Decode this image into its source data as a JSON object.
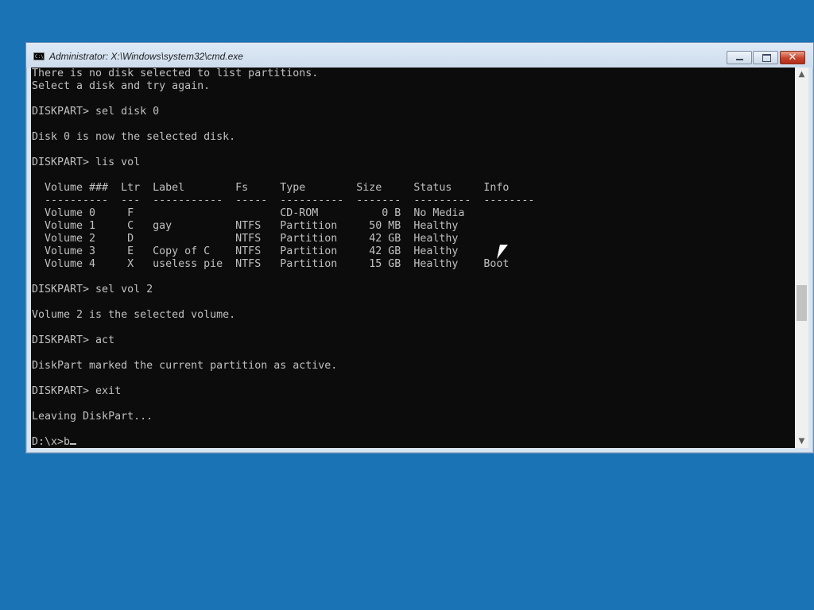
{
  "window": {
    "title": "Administrator: X:\\Windows\\system32\\cmd.exe",
    "icon": "cmd-icon",
    "icon_text": "C:\\",
    "controls": {
      "minimize": "minimize-icon",
      "maximize": "maximize-icon",
      "close": "close-icon",
      "close_glyph": "✕"
    }
  },
  "console": {
    "lines": [
      "There is no disk selected to list partitions.",
      "Select a disk and try again.",
      "",
      "DISKPART> sel disk 0",
      "",
      "Disk 0 is now the selected disk.",
      "",
      "DISKPART> lis vol",
      "",
      "  Volume ###  Ltr  Label        Fs     Type        Size     Status     Info",
      "  ----------  ---  -----------  -----  ----------  -------  ---------  --------",
      "  Volume 0     F                       CD-ROM          0 B  No Media",
      "  Volume 1     C   gay          NTFS   Partition     50 MB  Healthy",
      "  Volume 2     D                NTFS   Partition     42 GB  Healthy",
      "  Volume 3     E   Copy of C    NTFS   Partition     42 GB  Healthy",
      "  Volume 4     X   useless pie  NTFS   Partition     15 GB  Healthy    Boot",
      "",
      "DISKPART> sel vol 2",
      "",
      "Volume 2 is the selected volume.",
      "",
      "DISKPART> act",
      "",
      "DiskPart marked the current partition as active.",
      "",
      "DISKPART> exit",
      "",
      "Leaving DiskPart...",
      ""
    ],
    "prompt": "D:\\x>b",
    "text_color": "#c0c0c0",
    "background_color": "#0c0c0c"
  },
  "scrollbar": {
    "up_arrow": "▲",
    "down_arrow": "▼"
  },
  "desktop": {
    "background_color": "#1a73b4"
  }
}
